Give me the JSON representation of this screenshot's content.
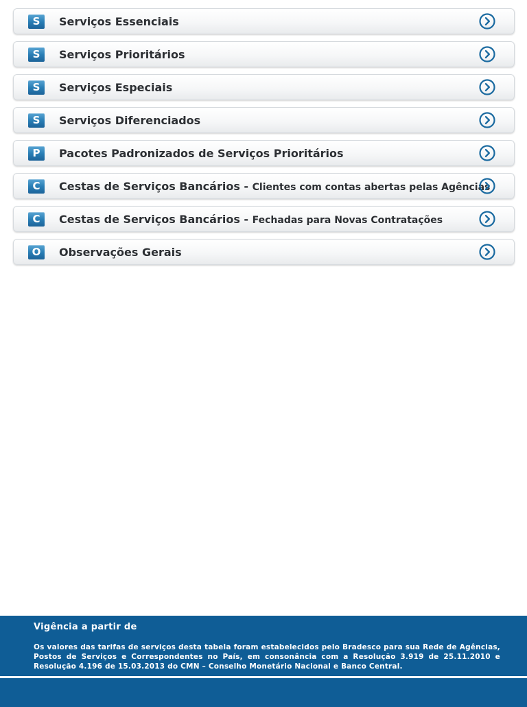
{
  "menu": {
    "items": [
      {
        "badge": "S",
        "label": "Serviços Essenciais"
      },
      {
        "badge": "S",
        "label": "Serviços Prioritários"
      },
      {
        "badge": "S",
        "label": "Serviços Especiais"
      },
      {
        "badge": "S",
        "label": "Serviços Diferenciados"
      },
      {
        "badge": "P",
        "label": "Pacotes Padronizados de Serviços Prioritários"
      },
      {
        "badge": "C",
        "label": "Cestas de Serviços Bancários",
        "separator": " - ",
        "sublabel": "Clientes com contas abertas pelas Agências"
      },
      {
        "badge": "C",
        "label": "Cestas de Serviços Bancários",
        "separator": " - ",
        "sublabel": "Fechadas para Novas Contratações"
      },
      {
        "badge": "O",
        "label": "Observações Gerais"
      }
    ],
    "arrow_icon": "chevron-right-circle-icon"
  },
  "footer": {
    "title": "Vigência a partir de",
    "text": "Os valores das tarifas de serviços desta tabela foram estabelecidos pelo Bradesco para sua Rede de Agências, Postos de Serviços e Correspondentes no País, em consonância com a Resolução 3.919 de 25.11.2010 e Resolução 4.196 de 15.03.2013 do CMN – Conselho Monetário Nacional e Banco Central."
  },
  "colors": {
    "accent": "#0f5d96",
    "badge": "#2a7fb6",
    "arrow": "#1a6aa0",
    "label_text": "#2c2f33"
  }
}
